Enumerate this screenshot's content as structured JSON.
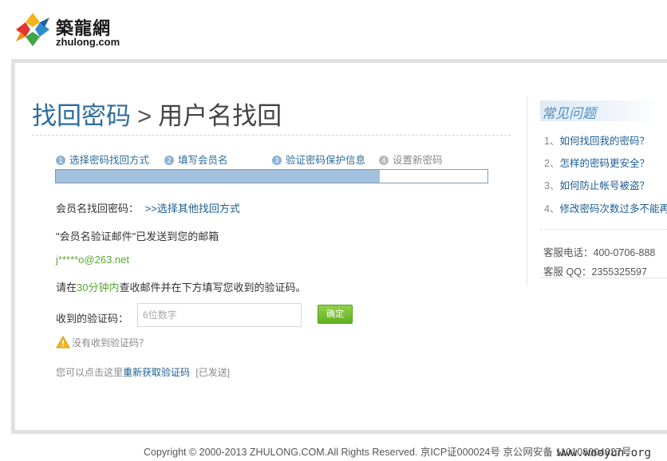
{
  "logo": {
    "cn": "築龍網",
    "en": "zhulong.com"
  },
  "page": {
    "title_main": "找回密码",
    "title_sep": ">",
    "title_sub": "用户名找回"
  },
  "steps": [
    {
      "num": "1",
      "label": "选择密码找回方式"
    },
    {
      "num": "2",
      "label": "填写会员名"
    },
    {
      "num": "3",
      "label": "验证密码保护信息"
    },
    {
      "num": "4",
      "label": "设置新密码"
    }
  ],
  "progress": {
    "fraction": 0.75
  },
  "content": {
    "method_label": "会员名找回密码：",
    "other_methods_link": ">>选择其他找回方式",
    "sent_message": "\"会员名验证邮件\"已发送到您的邮箱",
    "email": "j*****o@263.net",
    "instruction_pre": "请在",
    "instruction_time": "30分钟内",
    "instruction_post": "查收邮件并在下方填写您收到的验证码。",
    "code_label": "收到的验证码：",
    "code_placeholder": "6位数字",
    "code_value": "",
    "confirm_button": "确定",
    "not_received": "没有收到验证码？",
    "resend_pre": "您可以点击这里",
    "resend_link": "重新获取验证码",
    "resend_status": "[已发送]"
  },
  "sidebar": {
    "faq_title": "常见问题",
    "faqs": [
      {
        "idx": "1、",
        "q": "如何找回我的密码？"
      },
      {
        "idx": "2、",
        "q": "怎样的密码更安全？"
      },
      {
        "idx": "3、",
        "q": "如何防止帐号被盗？"
      },
      {
        "idx": "4、",
        "q": "修改密码次数过多不能再改"
      }
    ],
    "phone_label": "客服电话：",
    "phone": "400-0706-888",
    "qq_label": "客服 QQ：",
    "qq": "2355325597"
  },
  "footer": {
    "text": "Copyright © 2000-2013 ZHULONG.COM.All Rights Reserved. 京ICP证000024号 京公网安备 110108004327号"
  },
  "watermark": "www.wooyun.org",
  "colors": {
    "accent": "#2d6d9c",
    "link": "#1d5d90",
    "green": "#5aa832",
    "button": "#6cbb26",
    "progress": "#a3c0dc"
  },
  "icons": {
    "warning": "warning-icon"
  }
}
